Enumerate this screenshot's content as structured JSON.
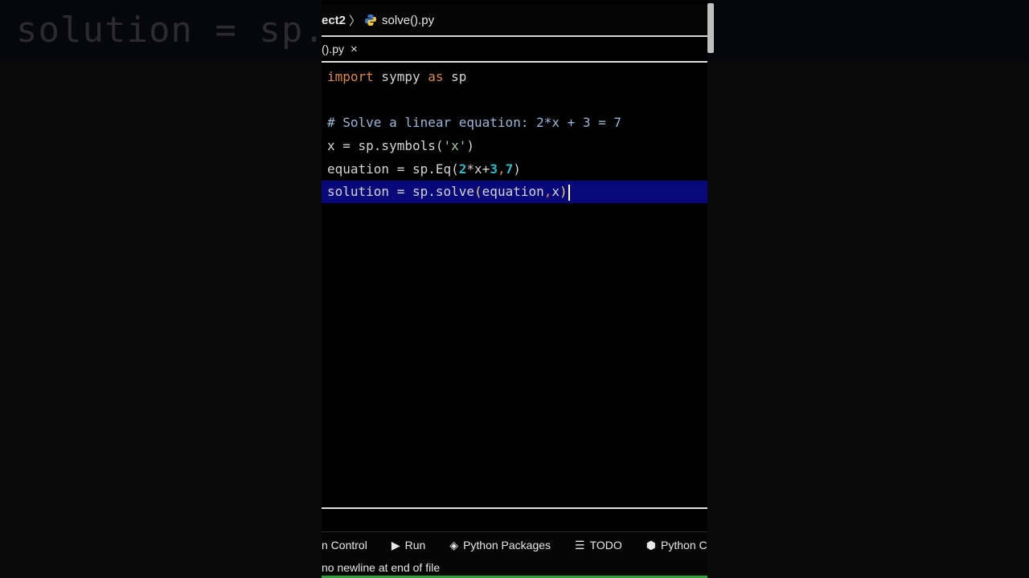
{
  "background": {
    "blurred_text": "solution = sp."
  },
  "breadcrumb": {
    "project": "ect2",
    "separator": "〉",
    "file": "solve().py"
  },
  "tab": {
    "label": "().py",
    "close": "×"
  },
  "code": {
    "line1": {
      "kw1": "import",
      "mod": " sympy ",
      "kw2": "as",
      "alias": " sp"
    },
    "line3": {
      "comment": "# Solve a linear equation: 2*x + 3 = 7"
    },
    "line4": {
      "pre": "x = sp.symbols(",
      "str": "'x'",
      "post": ")"
    },
    "line5": {
      "pre": "equation = sp.Eq(",
      "n1": "2",
      "mid": "*x+",
      "n2": "3",
      "comma": ",",
      "n3": "7",
      "post": ")"
    },
    "line6": {
      "pre": "solution = sp.solve",
      "open": "(",
      "arg1": "equation",
      "comma": ",",
      "arg2": "x",
      "close": ")"
    }
  },
  "toolwindows": [
    {
      "label": "n Control",
      "icon": ""
    },
    {
      "label": "Run",
      "icon": "▶"
    },
    {
      "label": "Python Packages",
      "icon": "◈"
    },
    {
      "label": "TODO",
      "icon": "☰"
    },
    {
      "label": "Python Co",
      "icon": "⬢"
    }
  ],
  "status": {
    "message": "no newline at end of file"
  },
  "colors": {
    "keyword": "#d98a4a",
    "comment": "#9ab6d6",
    "number": "#33b8c6",
    "highlight": "#08087a",
    "status_bar_accent": "#2e9d3e"
  }
}
